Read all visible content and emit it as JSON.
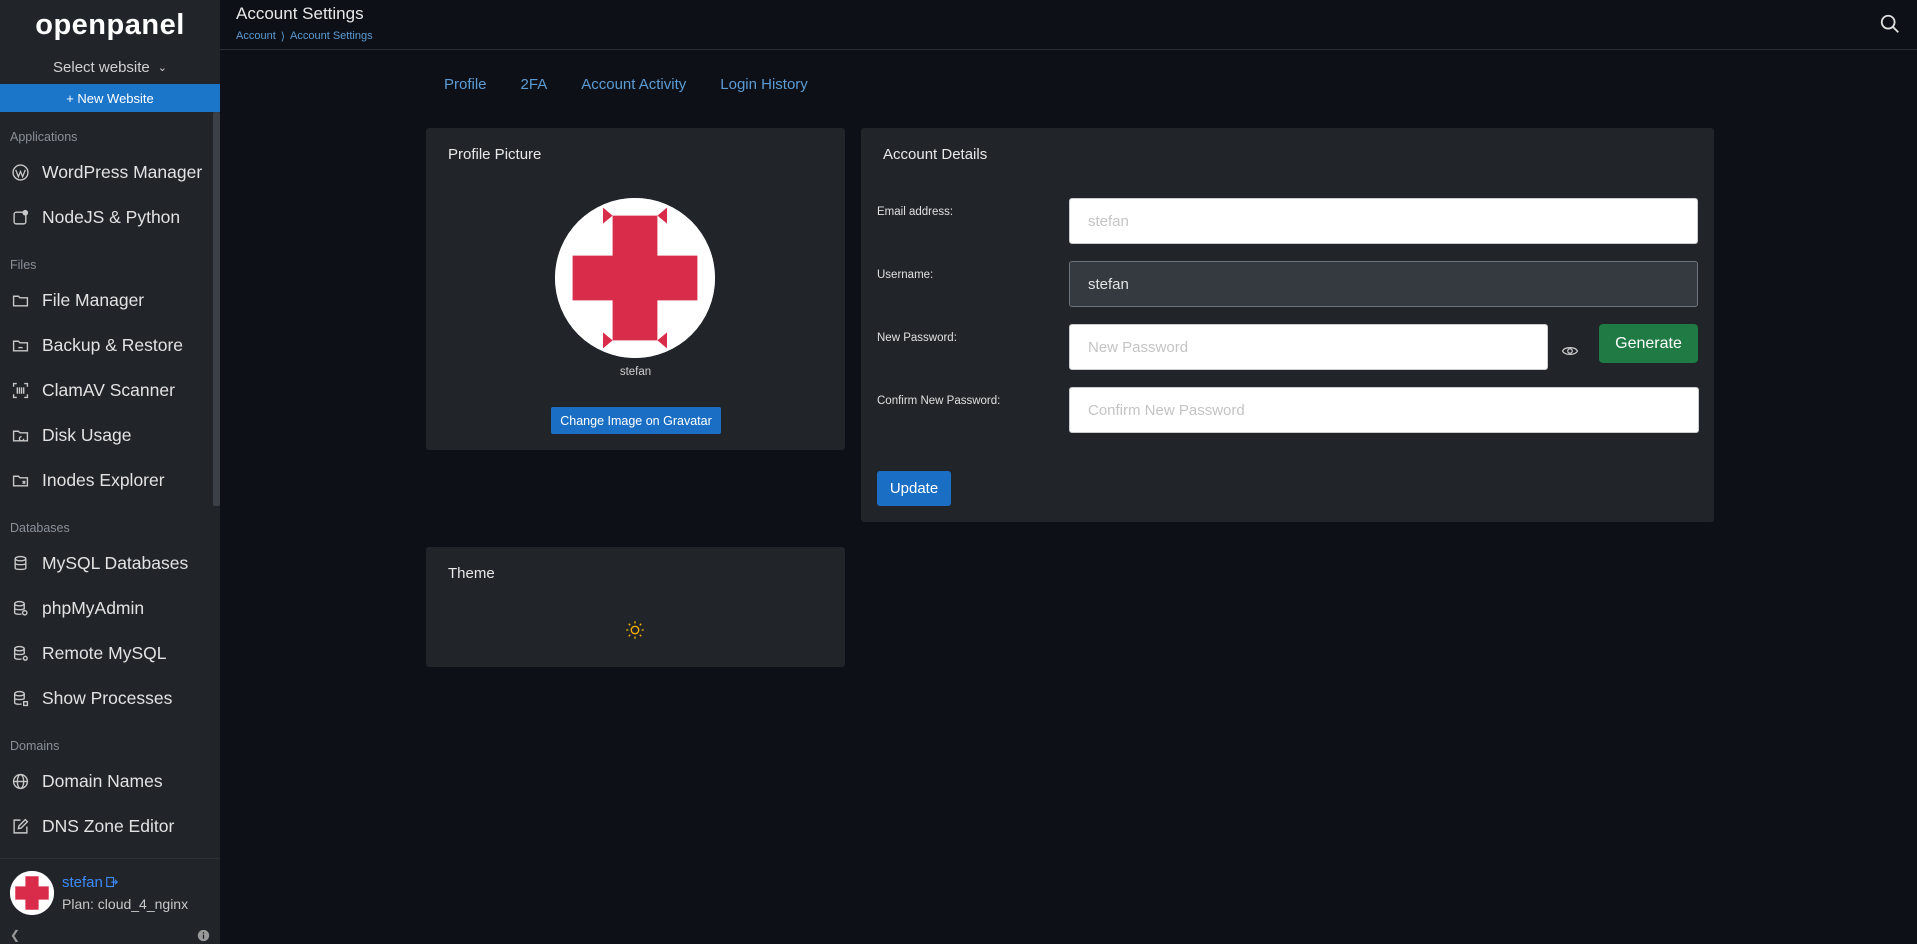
{
  "brand": "openpanel",
  "site_selector": {
    "label": "Select website"
  },
  "new_website_label": "+ New Website",
  "sidebar": {
    "sections": [
      {
        "label": "Applications",
        "items": [
          {
            "label": "WordPress Manager",
            "icon": "wordpress-icon"
          },
          {
            "label": "NodeJS & Python",
            "icon": "app-icon"
          }
        ]
      },
      {
        "label": "Files",
        "items": [
          {
            "label": "File Manager",
            "icon": "folder-icon"
          },
          {
            "label": "Backup & Restore",
            "icon": "folder-sync-icon"
          },
          {
            "label": "ClamAV Scanner",
            "icon": "barcode-scan-icon"
          },
          {
            "label": "Disk Usage",
            "icon": "folder-chart-icon"
          },
          {
            "label": "Inodes Explorer",
            "icon": "folder-x-icon"
          }
        ]
      },
      {
        "label": "Databases",
        "items": [
          {
            "label": "MySQL Databases",
            "icon": "database-icon"
          },
          {
            "label": "phpMyAdmin",
            "icon": "database-cog-icon"
          },
          {
            "label": "Remote MySQL",
            "icon": "database-remote-icon"
          },
          {
            "label": "Show Processes",
            "icon": "database-process-icon"
          }
        ]
      },
      {
        "label": "Domains",
        "items": [
          {
            "label": "Domain Names",
            "icon": "globe-icon"
          },
          {
            "label": "DNS Zone Editor",
            "icon": "edit-icon"
          }
        ]
      }
    ]
  },
  "user": {
    "name": "stefan",
    "plan": "Plan: cloud_4_nginx"
  },
  "header": {
    "title": "Account Settings",
    "breadcrumb": [
      "Account",
      "Account Settings"
    ]
  },
  "tabs": [
    "Profile",
    "2FA",
    "Account Activity",
    "Login History"
  ],
  "profile_card": {
    "title": "Profile Picture",
    "caption": "stefan",
    "button": "Change Image on Gravatar"
  },
  "theme_card": {
    "title": "Theme"
  },
  "account_details": {
    "title": "Account Details",
    "email": {
      "label": "Email address:",
      "placeholder": "stefan"
    },
    "username": {
      "label": "Username:",
      "value": "stefan"
    },
    "new_password": {
      "label": "New Password:",
      "placeholder": "New Password"
    },
    "confirm_password": {
      "label": "Confirm New Password:",
      "placeholder": "Confirm New Password"
    },
    "generate": "Generate",
    "update": "Update"
  },
  "colors": {
    "accent": "#1a6fc4",
    "generate": "#1f7a43",
    "avatar_red": "#d92b4a",
    "sun": "#f5b301"
  }
}
